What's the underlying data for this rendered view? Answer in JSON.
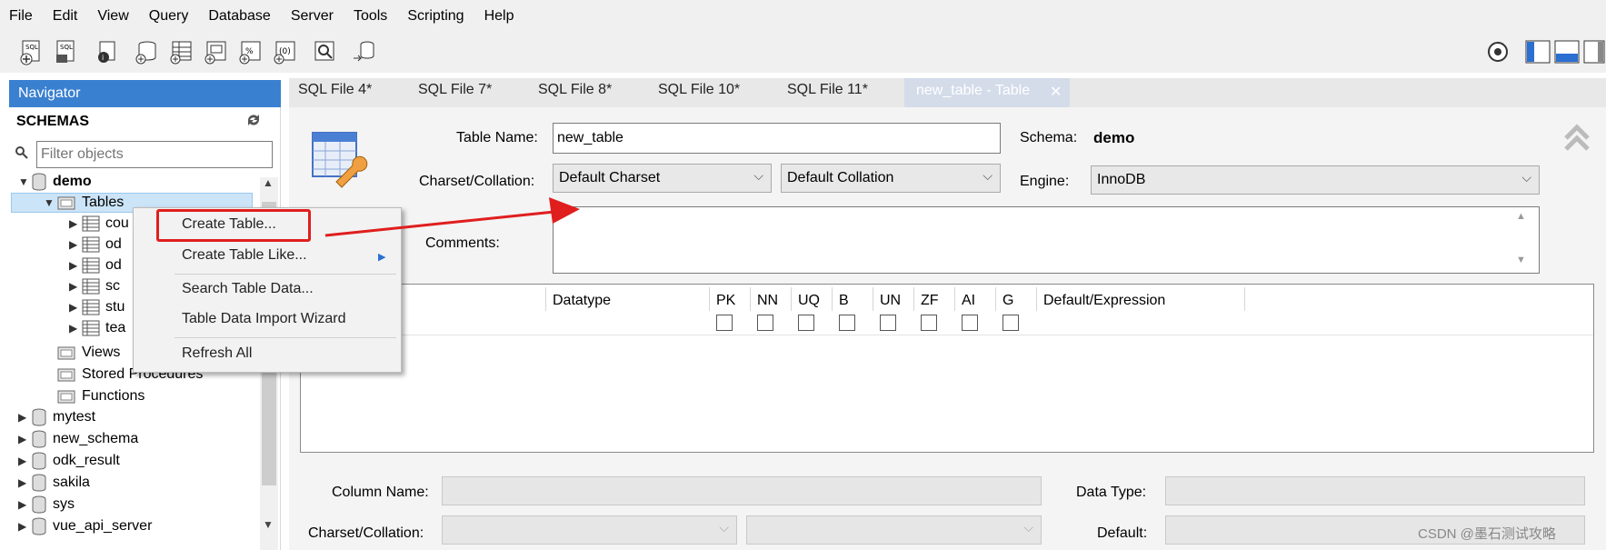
{
  "menu": [
    "File",
    "Edit",
    "View",
    "Query",
    "Database",
    "Server",
    "Tools",
    "Scripting",
    "Help"
  ],
  "navigator": {
    "title": "Navigator",
    "schemas_label": "SCHEMAS",
    "filter_placeholder": "Filter objects",
    "schema_demo": "demo",
    "tables": "Tables",
    "table_stubs": [
      "cou",
      "od",
      "od",
      "sc",
      "stu",
      "tea"
    ],
    "views": "Views",
    "stored_procedures": "Stored Procedures",
    "functions": "Functions",
    "other_schemas": [
      "mytest",
      "new_schema",
      "odk_result",
      "sakila",
      "sys",
      "vue_api_server"
    ]
  },
  "context_menu": {
    "create_table": "Create Table...",
    "create_table_like": "Create Table Like...",
    "search_table_data": "Search Table Data...",
    "import_wizard": "Table Data Import Wizard",
    "refresh_all": "Refresh All"
  },
  "tabs": [
    "SQL File 4*",
    "SQL File 7*",
    "SQL File 8*",
    "SQL File 10*",
    "SQL File 11*"
  ],
  "active_tab": "new_table - Table",
  "editor": {
    "table_name_label": "Table Name:",
    "table_name_value": "new_table",
    "schema_label": "Schema:",
    "schema_value": "demo",
    "charset_label": "Charset/Collation:",
    "charset_value": "Default Charset",
    "collation_value": "Default Collation",
    "engine_label": "Engine:",
    "engine_value": "InnoDB",
    "comments_label": "Comments:"
  },
  "grid": {
    "headers": [
      "Datatype",
      "PK",
      "NN",
      "UQ",
      "B",
      "UN",
      "ZF",
      "AI",
      "G",
      "Default/Expression"
    ]
  },
  "bottom": {
    "column_name_label": "Column Name:",
    "charset_label": "Charset/Collation:",
    "data_type_label": "Data Type:",
    "default_label": "Default:"
  },
  "watermark": "CSDN @墨石测试攻略",
  "colors": {
    "nav_header": "#3a80d0",
    "highlight": "#e01e1e",
    "arrow": "#e01e1e"
  }
}
